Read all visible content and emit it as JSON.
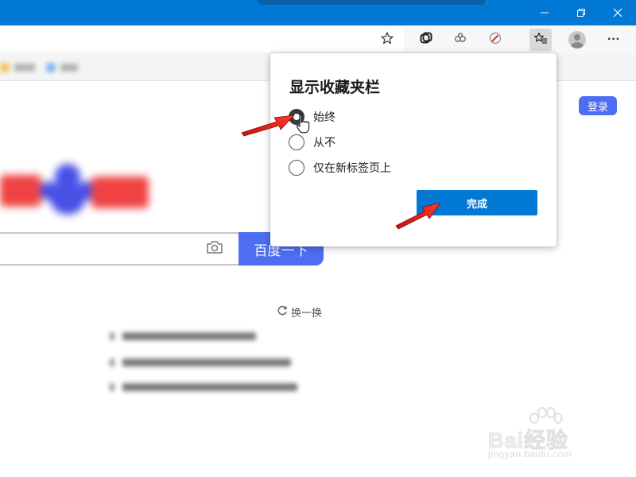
{
  "window": {
    "controls": [
      "minimize-icon",
      "restore-icon",
      "close-icon"
    ]
  },
  "toolbar": {
    "icons": [
      "star-add-icon",
      "collections-icon",
      "extension-icon",
      "extension2-icon",
      "favorites-icon",
      "profile-icon",
      "more-icon"
    ],
    "more_label": "···"
  },
  "page": {
    "login_label": "登录",
    "search_button_label": "百度一下",
    "refresh_label": "换一换",
    "accent_color": "#4e6ef2"
  },
  "dialog": {
    "title": "显示收藏夹栏",
    "options": [
      {
        "label": "始终",
        "selected": true
      },
      {
        "label": "从不",
        "selected": false
      },
      {
        "label": "仅在新标签页上",
        "selected": false
      }
    ],
    "done_label": "完成",
    "button_color": "#0078d4"
  },
  "watermark": {
    "main": "Bai经验",
    "sub": "jingyan.baidu.com"
  },
  "colors": {
    "titlebar": "#0078d4",
    "annotation_arrow": "#e5231b"
  }
}
